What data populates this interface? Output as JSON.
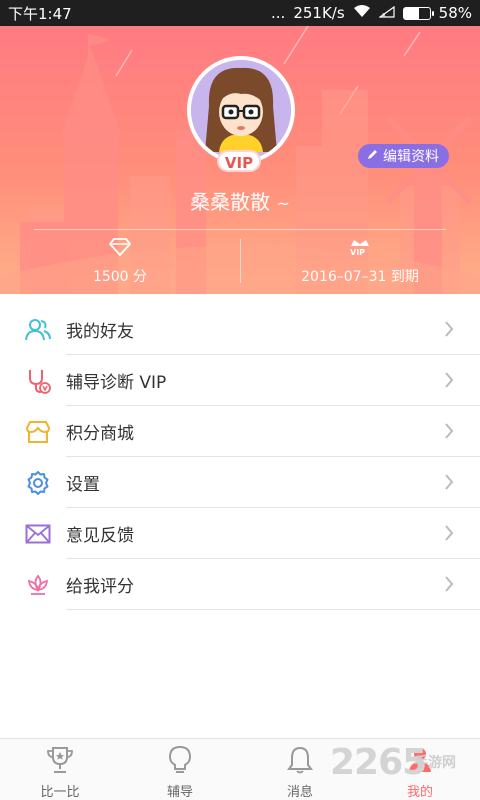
{
  "status_bar": {
    "time": "下午1:47",
    "dots": "...",
    "speed": "251K/s",
    "battery": "58%",
    "battery_level": 0.58
  },
  "profile": {
    "avatar_badge": "VIP",
    "edit_label": "编辑资料",
    "username": "桑桑散散",
    "points": "1500 分",
    "vip_expiry": "2016–07–31 到期",
    "vip_icon_text": "VIP"
  },
  "menu": {
    "items": [
      {
        "label": "我的好友",
        "icon": "friends-icon",
        "color": "#3fc2d6"
      },
      {
        "label": "辅导诊断 VIP",
        "icon": "diagnosis-vip-icon",
        "color": "#f0606e"
      },
      {
        "label": "积分商城",
        "icon": "store-icon",
        "color": "#f3b32c"
      },
      {
        "label": "设置",
        "icon": "gear-icon",
        "color": "#4a8fe0"
      },
      {
        "label": "意见反馈",
        "icon": "mail-icon",
        "color": "#9b6fd6"
      },
      {
        "label": "给我评分",
        "icon": "lotus-icon",
        "color": "#ef6fa7"
      }
    ]
  },
  "bottom_nav": {
    "items": [
      {
        "label": "比一比",
        "icon": "trophy-icon"
      },
      {
        "label": "辅导",
        "icon": "bulb-icon"
      },
      {
        "label": "消息",
        "icon": "bell-icon"
      },
      {
        "label": "我的",
        "icon": "person-icon"
      }
    ],
    "active_color": "#ff6a6a"
  },
  "watermark": {
    "text": "2265",
    "sub": "手游网"
  }
}
